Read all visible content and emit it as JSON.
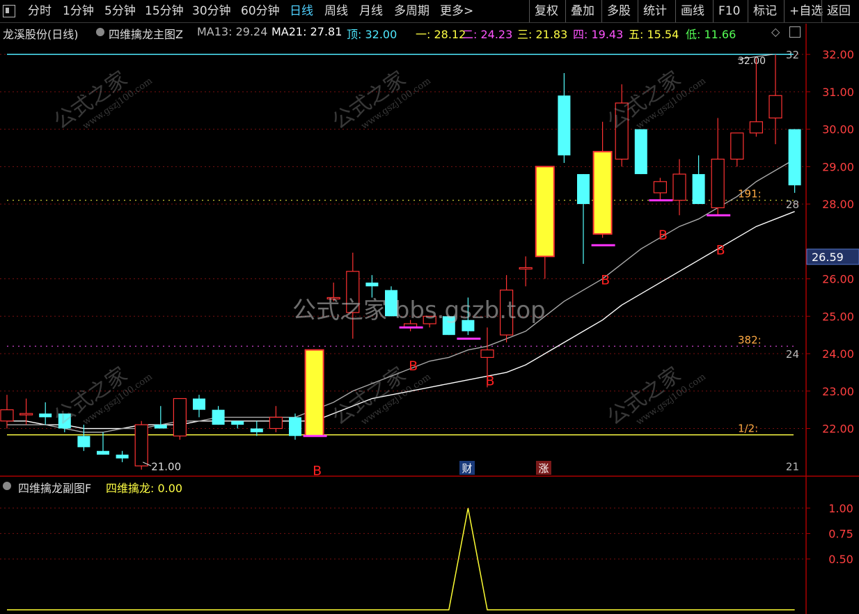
{
  "toolbar": {
    "tabs": [
      "分时",
      "1分钟",
      "5分钟",
      "15分钟",
      "30分钟",
      "60分钟",
      "日线",
      "周线",
      "月线",
      "多周期",
      "更多>"
    ],
    "active": "日线",
    "right": [
      "复权",
      "叠加",
      "多股",
      "统计",
      "画线",
      "F10",
      "标记",
      "+自选",
      "返回"
    ]
  },
  "legend": {
    "stock": "龙溪股份(日线)",
    "indicator": "四维擒龙主图Z",
    "ma13": "MA13: 29.24",
    "ma21": "MA21: 27.81",
    "top": "顶: 32.00",
    "l1": "一: 28.12",
    "l2": "二: 24.23",
    "l3": "三: 21.83",
    "l4": "四: 19.43",
    "l5": "五: 15.54",
    "low": "低: 11.66"
  },
  "sublegend": {
    "name": "四维擒龙副图F",
    "value": "四维擒龙: 0.00"
  },
  "watermark": {
    "center": "公式之家 bbs.gszb.top",
    "stamp": "公式之家",
    "stamp_url": "www.gszj100.com"
  },
  "chart_data": {
    "type": "candlestick",
    "ylim": [
      20.8,
      32.3
    ],
    "y_ticks": [
      "32.00",
      "31.00",
      "30.00",
      "29.00",
      "28.00",
      "26.00",
      "25.00",
      "24.00",
      "23.00",
      "22.00"
    ],
    "inner_ticks": [
      "32",
      "28",
      "24",
      "21"
    ],
    "current_price": "26.59",
    "annotations": {
      "high": "32.00",
      "low": "21.00",
      "fib191": "191:",
      "fib382": "382:",
      "fib_half": "1/2:",
      "b_label": "B",
      "cai": "财",
      "zhang": "涨"
    },
    "candles": [
      {
        "o": 22.2,
        "h": 22.9,
        "l": 22.0,
        "c": 22.5
      },
      {
        "o": 22.4,
        "h": 22.8,
        "l": 22.1,
        "c": 22.4
      },
      {
        "o": 22.4,
        "h": 22.7,
        "l": 22.1,
        "c": 22.3
      },
      {
        "o": 22.4,
        "h": 22.4,
        "l": 21.9,
        "c": 22.0
      },
      {
        "o": 21.8,
        "h": 22.1,
        "l": 21.4,
        "c": 21.5
      },
      {
        "o": 21.4,
        "h": 21.9,
        "l": 21.3,
        "c": 21.3
      },
      {
        "o": 21.3,
        "h": 21.4,
        "l": 21.1,
        "c": 21.2
      },
      {
        "o": 21.0,
        "h": 22.2,
        "l": 20.9,
        "c": 22.1
      },
      {
        "o": 22.1,
        "h": 22.6,
        "l": 22.0,
        "c": 22.0
      },
      {
        "o": 21.8,
        "h": 22.7,
        "l": 21.7,
        "c": 22.8
      },
      {
        "o": 22.8,
        "h": 22.9,
        "l": 22.3,
        "c": 22.5
      },
      {
        "o": 22.5,
        "h": 22.6,
        "l": 22.1,
        "c": 22.1
      },
      {
        "o": 22.2,
        "h": 22.2,
        "l": 22.0,
        "c": 22.1
      },
      {
        "o": 22.0,
        "h": 22.2,
        "l": 21.8,
        "c": 21.9
      },
      {
        "o": 22.0,
        "h": 22.6,
        "l": 21.9,
        "c": 22.3
      },
      {
        "o": 22.3,
        "h": 22.4,
        "l": 21.7,
        "c": 21.8
      },
      {
        "o": 21.8,
        "h": 24.1,
        "l": 21.8,
        "c": 24.1
      },
      {
        "o": 25.5,
        "h": 25.9,
        "l": 25.4,
        "c": 25.5
      },
      {
        "o": 25.1,
        "h": 26.7,
        "l": 24.4,
        "c": 26.2
      },
      {
        "o": 25.9,
        "h": 26.1,
        "l": 25.5,
        "c": 25.8
      },
      {
        "o": 25.7,
        "h": 25.8,
        "l": 25.0,
        "c": 25.0
      },
      {
        "o": 24.7,
        "h": 24.9,
        "l": 24.6,
        "c": 24.8
      },
      {
        "o": 24.8,
        "h": 25.0,
        "l": 24.7,
        "c": 25.0
      },
      {
        "o": 25.0,
        "h": 25.0,
        "l": 24.5,
        "c": 24.5
      },
      {
        "o": 24.9,
        "h": 25.5,
        "l": 24.5,
        "c": 24.6
      },
      {
        "o": 23.9,
        "h": 24.7,
        "l": 23.1,
        "c": 24.1
      },
      {
        "o": 24.5,
        "h": 26.1,
        "l": 24.3,
        "c": 25.7
      },
      {
        "o": 26.3,
        "h": 26.6,
        "l": 25.8,
        "c": 26.3
      },
      {
        "o": 26.6,
        "h": 29.0,
        "l": 26.0,
        "c": 29.0
      },
      {
        "o": 30.9,
        "h": 31.5,
        "l": 29.1,
        "c": 29.3
      },
      {
        "o": 28.8,
        "h": 28.8,
        "l": 26.4,
        "c": 28.0
      },
      {
        "o": 27.2,
        "h": 30.2,
        "l": 27.1,
        "c": 29.4
      },
      {
        "o": 29.2,
        "h": 31.2,
        "l": 29.0,
        "c": 30.7
      },
      {
        "o": 30.0,
        "h": 30.0,
        "l": 28.8,
        "c": 28.8
      },
      {
        "o": 28.3,
        "h": 28.7,
        "l": 28.1,
        "c": 28.6
      },
      {
        "o": 28.1,
        "h": 29.2,
        "l": 27.7,
        "c": 28.8
      },
      {
        "o": 28.8,
        "h": 29.3,
        "l": 28.0,
        "c": 28.0
      },
      {
        "o": 27.9,
        "h": 30.3,
        "l": 27.7,
        "c": 29.2
      },
      {
        "o": 29.2,
        "h": 29.9,
        "l": 29.0,
        "c": 29.9
      },
      {
        "o": 29.9,
        "h": 31.9,
        "l": 29.8,
        "c": 30.2
      },
      {
        "o": 30.3,
        "h": 32.0,
        "l": 29.6,
        "c": 30.9
      },
      {
        "o": 30.0,
        "h": 30.0,
        "l": 28.3,
        "c": 28.5
      }
    ],
    "ma13": [
      22.1,
      22.1,
      22.1,
      22.0,
      21.9,
      21.9,
      22.0,
      22.0,
      22.1,
      22.2,
      22.2,
      22.3,
      22.3,
      22.3,
      22.3,
      22.3,
      22.5,
      22.7,
      23.0,
      23.2,
      23.4,
      23.6,
      23.8,
      23.9,
      24.1,
      24.2,
      24.4,
      24.6,
      25.0,
      25.4,
      25.7,
      26.0,
      26.4,
      26.8,
      27.1,
      27.4,
      27.6,
      27.9,
      28.2,
      28.6,
      28.9,
      29.2
    ],
    "ma21": [
      22.2,
      22.2,
      22.1,
      22.1,
      22.0,
      22.0,
      22.0,
      22.1,
      22.1,
      22.1,
      22.2,
      22.2,
      22.2,
      22.2,
      22.2,
      22.2,
      22.2,
      22.4,
      22.6,
      22.8,
      22.9,
      23.0,
      23.1,
      23.2,
      23.3,
      23.4,
      23.5,
      23.7,
      24.0,
      24.3,
      24.6,
      24.9,
      25.3,
      25.6,
      25.9,
      26.2,
      26.5,
      26.8,
      27.1,
      27.4,
      27.6,
      27.8
    ],
    "sub_series": {
      "name": "四维擒龙",
      "values": [
        0,
        0,
        0,
        0,
        0,
        0,
        0,
        0,
        0,
        0,
        0,
        0,
        0,
        0,
        0,
        0,
        0,
        0,
        0,
        0,
        0,
        0,
        0,
        0,
        1,
        0,
        0,
        0,
        0,
        0,
        0,
        0,
        0,
        0,
        0,
        0,
        0,
        0,
        0,
        0,
        0,
        0
      ]
    },
    "sub_ylim": [
      0,
      1.15
    ],
    "sub_ticks": [
      "1.00",
      "0.75",
      "0.50"
    ]
  }
}
